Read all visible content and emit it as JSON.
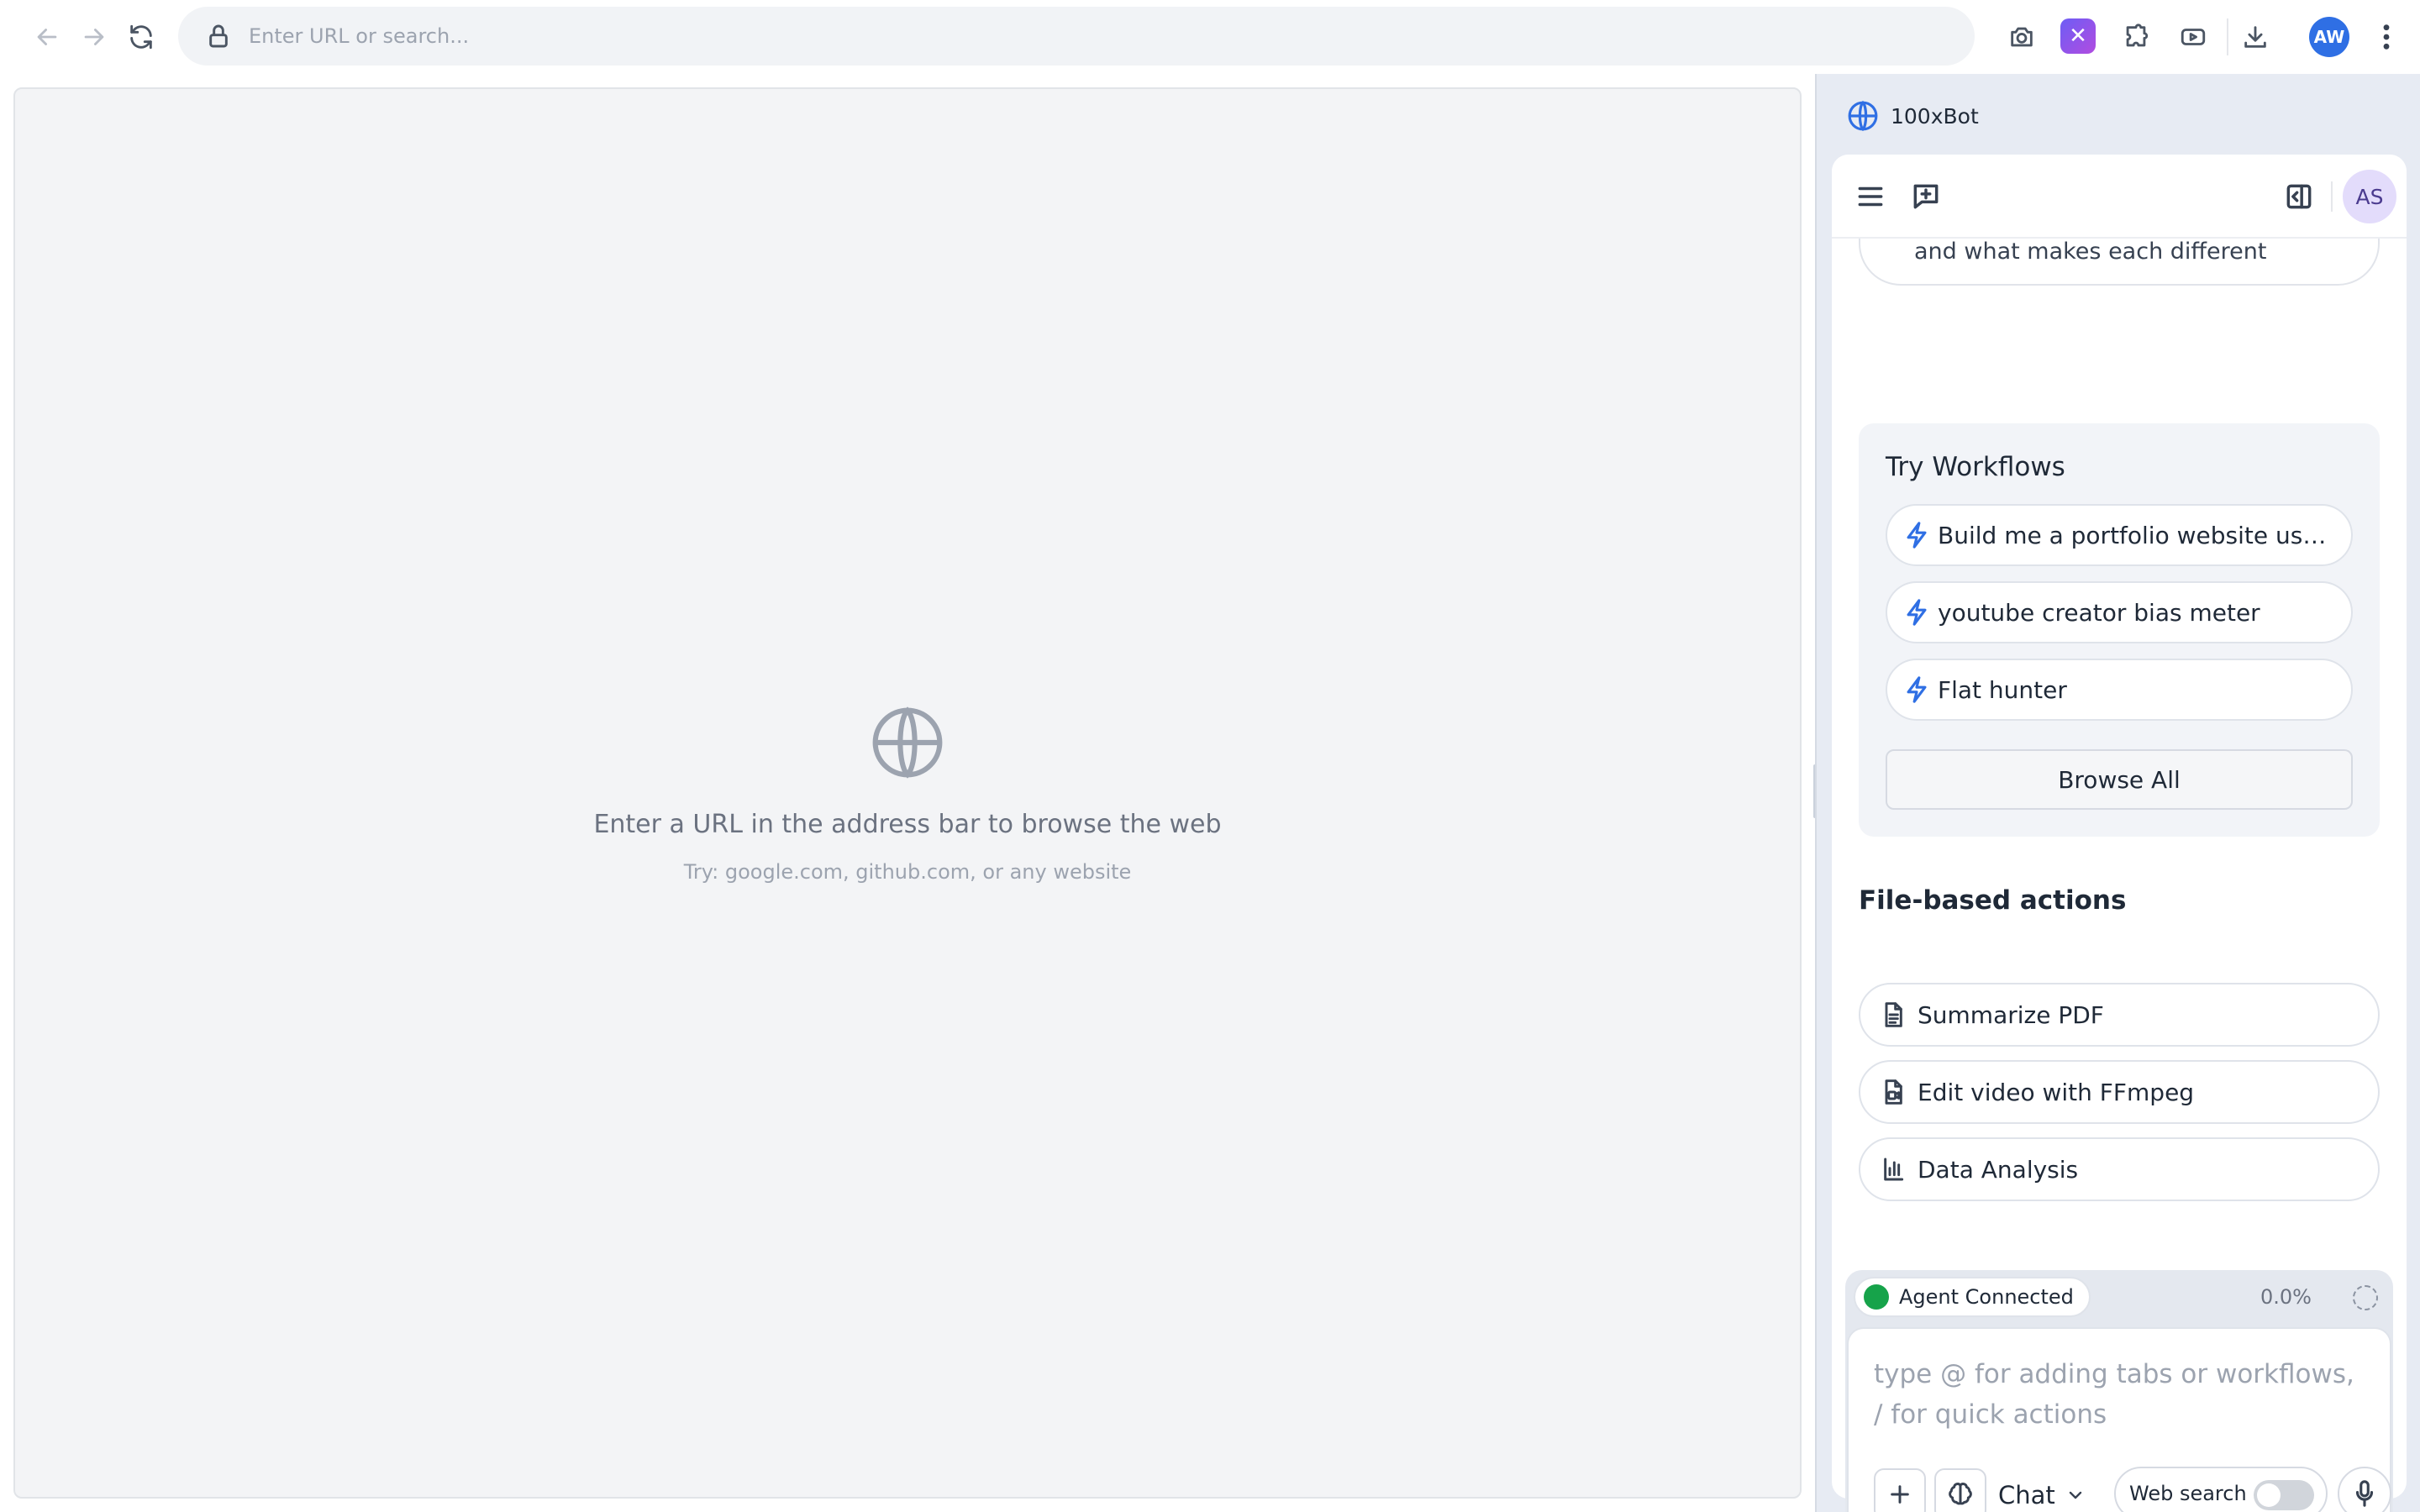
{
  "toolbar": {
    "url_placeholder": "Enter URL or search...",
    "extension_badge": "✕",
    "profile_initials": "AW",
    "icons": [
      "back-arrow-icon",
      "forward-arrow-icon",
      "reload-icon",
      "lock-icon",
      "camera-icon",
      "puzzle-icon",
      "video-icon",
      "download-icon",
      "kebab-menu-icon"
    ]
  },
  "webview": {
    "empty_title": "Enter a URL in the address bar to browse the web",
    "empty_hint": "Try: google.com, github.com, or any website"
  },
  "side_panel": {
    "app_name": "100xBot",
    "user_initials": "AS",
    "previous_prompt_partial": "name/URL and list their website, size, and what makes each different",
    "workflows": {
      "title": "Try Workflows",
      "items": [
        "Build me a portfolio website using li...",
        "youtube creator bias meter",
        "Flat hunter"
      ],
      "browse_all": "Browse All"
    },
    "file_actions": {
      "title": "File-based actions",
      "items": [
        "Summarize PDF",
        "Edit video with FFmpeg",
        "Data Analysis"
      ]
    },
    "composer": {
      "status": "Agent Connected",
      "progress": "0.0%",
      "placeholder": "type @ for adding tabs or workflows, / for quick actions",
      "mode": "Chat",
      "web_search_label": "Web search",
      "web_search_enabled": false
    }
  },
  "colors": {
    "accent": "#2f6fe4",
    "connected": "#16a34a",
    "extension_gradient_start": "#6d5df5",
    "extension_gradient_end": "#b14ce0"
  }
}
